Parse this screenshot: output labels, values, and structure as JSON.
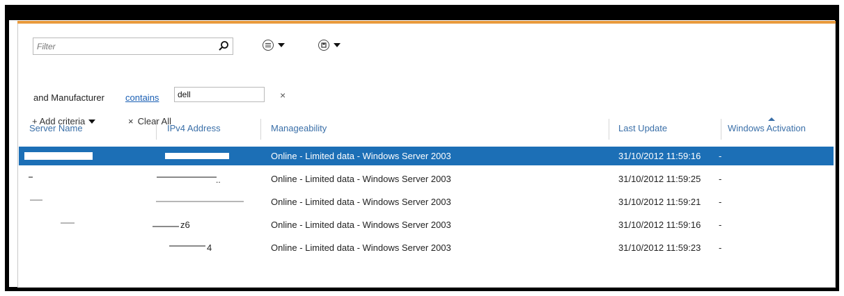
{
  "filter": {
    "placeholder": "Filter"
  },
  "criteria": {
    "prefix": "and Manufacturer",
    "operator": "contains",
    "value": "dell",
    "remove_glyph": "×"
  },
  "actions": {
    "add_criteria": "+ Add criteria",
    "clear_all_glyph": "×",
    "clear_all": "Clear All"
  },
  "table": {
    "columns": [
      "Server Name",
      "IPv4 Address",
      "Manageability",
      "Last Update",
      "Windows Activation"
    ],
    "rows": [
      {
        "manageability": "Online - Limited data - Windows Server 2003",
        "last_update": "31/10/2012 11:59:16",
        "activation": "-",
        "selected": true
      },
      {
        "manageability": "Online - Limited data - Windows Server 2003",
        "last_update": "31/10/2012 11:59:25",
        "activation": "-",
        "selected": false
      },
      {
        "manageability": "Online - Limited data - Windows Server 2003",
        "last_update": "31/10/2012 11:59:21",
        "activation": "-",
        "selected": false
      },
      {
        "manageability": "Online - Limited data - Windows Server 2003",
        "last_update": "31/10/2012 11:59:16",
        "activation": "-",
        "selected": false
      },
      {
        "manageability": "Online - Limited data - Windows Server 2003",
        "last_update": "31/10/2012 11:59:23",
        "activation": "-",
        "selected": false
      }
    ],
    "ip_fragments": [
      "..",
      "",
      "z6",
      "4"
    ]
  },
  "icons": {
    "search": "search-icon",
    "view_options": "list-options-icon",
    "saved_filters": "saved-filter-icon",
    "sort_ascending": "sort-ascending-icon"
  },
  "colors": {
    "accent_bar": "#e89a3c",
    "selection": "#1c6fb6",
    "header_text": "#3a6fa8",
    "link": "#1a5fb4"
  }
}
